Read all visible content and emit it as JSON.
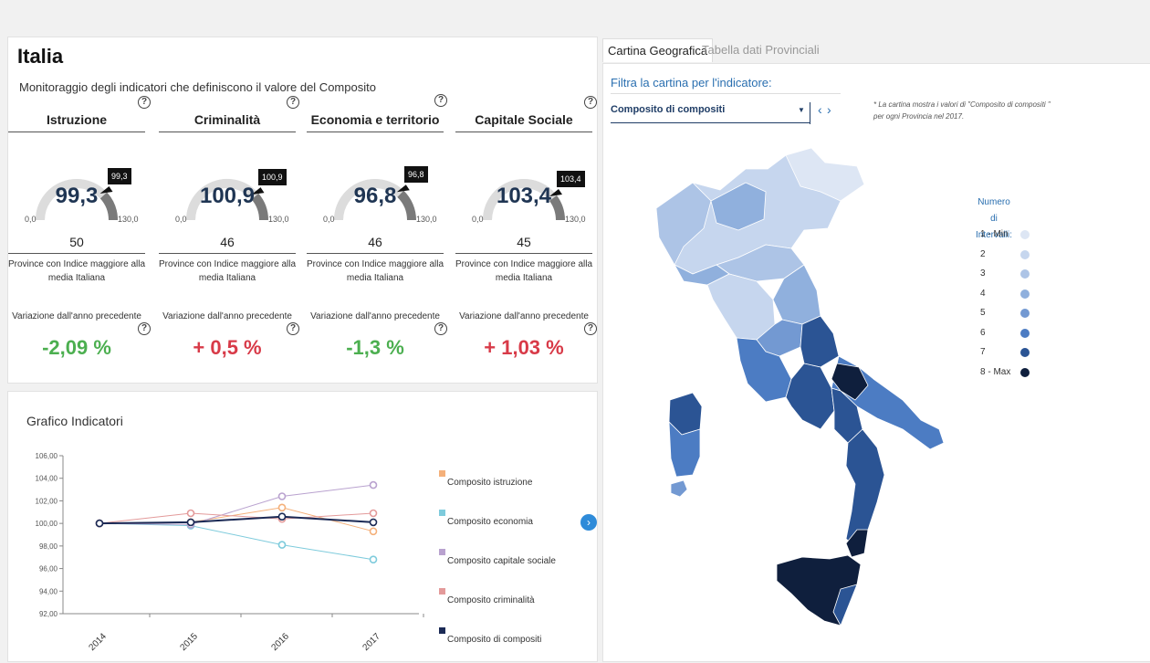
{
  "header": {
    "title": "Italia",
    "subtitle": "Monitoraggio degli indicatori che definiscono il valore del Composito"
  },
  "indicators": [
    {
      "title": "Istruzione",
      "value": "99,3",
      "flag": "99,3",
      "min": "0,0",
      "max": "130,0",
      "count": "50",
      "count_text": "Province con Indice maggiore alla media Italiana",
      "variation_label": "Variazione dall'anno precedente",
      "variation": "-2,09 %",
      "variation_color": "#4caf50",
      "gauge_fraction": 0.764
    },
    {
      "title": "Criminalità",
      "value": "100,9",
      "flag": "100,9",
      "min": "0,0",
      "max": "130,0",
      "count": "46",
      "count_text": "Province con Indice maggiore alla media Italiana",
      "variation_label": "Variazione dall'anno precedente",
      "variation": "+ 0,5 %",
      "variation_color": "#d83a48",
      "gauge_fraction": 0.776
    },
    {
      "title": "Economia e territorio",
      "value": "96,8",
      "flag": "96,8",
      "min": "0,0",
      "max": "130,0",
      "count": "46",
      "count_text": "Province con Indice maggiore alla media Italiana",
      "variation_label": "Variazione dall'anno precedente",
      "variation": "-1,3 %",
      "variation_color": "#4caf50",
      "gauge_fraction": 0.745
    },
    {
      "title": "Capitale Sociale",
      "value": "103,4",
      "flag": "103,4",
      "min": "0,0",
      "max": "130,0",
      "count": "45",
      "count_text": "Province con Indice maggiore alla media Italiana",
      "variation_label": "Variazione dall'anno precedente",
      "variation": "+ 1,03 %",
      "variation_color": "#d83a48",
      "gauge_fraction": 0.795
    }
  ],
  "help_icon_glyph": "?",
  "chart_panel": {
    "title": "Grafico Indicatori",
    "next_icon": "chevron-right-icon"
  },
  "chart_data": {
    "type": "line",
    "title": "Grafico Indicatori",
    "categories": [
      "2014",
      "2015",
      "2016",
      "2017"
    ],
    "yticks": [
      "106,00",
      "104,00",
      "102,00",
      "100,00",
      "98,00",
      "96,00",
      "94,00",
      "92,00"
    ],
    "ylim": [
      92,
      106
    ],
    "series": [
      {
        "name": "Composito istruzione",
        "color": "#f4b07a",
        "values": [
          100,
          100.1,
          101.4,
          99.3
        ]
      },
      {
        "name": "Composito economia",
        "color": "#7ecbdc",
        "values": [
          100,
          99.8,
          98.1,
          96.8
        ]
      },
      {
        "name": "Composito capitale sociale",
        "color": "#b9a2cf",
        "values": [
          100,
          99.9,
          102.4,
          103.4
        ]
      },
      {
        "name": "Composito criminalità",
        "color": "#e39a9a",
        "values": [
          100,
          100.9,
          100.4,
          100.9
        ]
      },
      {
        "name": "Composito di compositi",
        "color": "#1b2a55",
        "values": [
          100,
          100.1,
          100.6,
          100.1
        ]
      }
    ]
  },
  "tabs": [
    {
      "label": "Cartina Geografica",
      "active": true
    },
    {
      "label": "Tabella dati Provinciali",
      "active": false
    }
  ],
  "map_panel": {
    "filter_label": "Filtra la cartina per l'indicatore:",
    "select_value": "Composito di compositi",
    "caret": "▼",
    "prev": "‹",
    "next": "›",
    "note": "* La cartina mostra i valori di \"Composito di compositi \" per ogni Provincia nel 2017.",
    "legend_title_1": "Numero di",
    "legend_title_2": "Intervalli:",
    "legend": [
      {
        "label": "1 - Min",
        "color": "#dde6f4"
      },
      {
        "label": "2",
        "color": "#c6d6ee"
      },
      {
        "label": "3",
        "color": "#adc4e6"
      },
      {
        "label": "4",
        "color": "#90b0dd"
      },
      {
        "label": "5",
        "color": "#7399d2"
      },
      {
        "label": "6",
        "color": "#4c7cc3"
      },
      {
        "label": "7",
        "color": "#2b5494"
      },
      {
        "label": "8 - Max",
        "color": "#0f1f3d"
      }
    ]
  }
}
